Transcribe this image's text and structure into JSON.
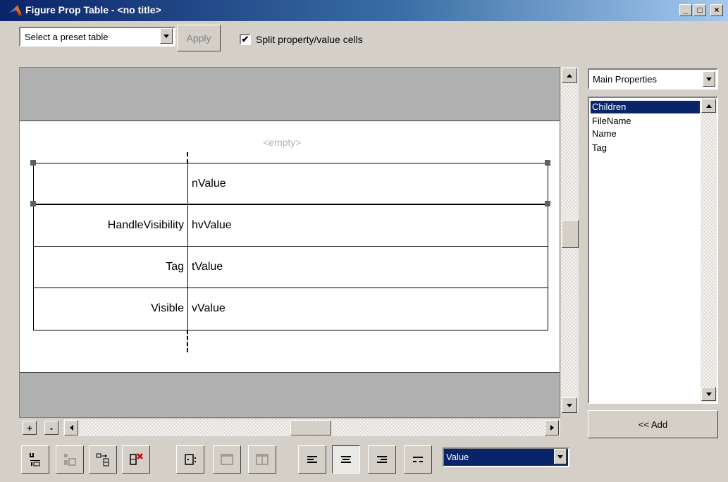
{
  "window": {
    "title": "Figure Prop Table - <no title>",
    "controls": [
      "_",
      "□",
      "×"
    ]
  },
  "toolbar": {
    "preset_placeholder": "Select a preset table",
    "apply_label": "Apply",
    "apply_enabled": false,
    "split_checked": true,
    "split_check_glyph": "✔",
    "split_label": "Split property/value cells"
  },
  "canvas": {
    "empty_placeholder": "<empty>",
    "rows": [
      {
        "property": "",
        "value": "nValue",
        "selected": true
      },
      {
        "property": "HandleVisibility",
        "value": "hvValue",
        "selected": false
      },
      {
        "property": "Tag",
        "value": "tValue",
        "selected": false
      },
      {
        "property": "Visible",
        "value": "vValue",
        "selected": false
      }
    ],
    "add_row_label": "+",
    "remove_row_label": "-"
  },
  "properties_panel": {
    "category": "Main Properties",
    "items": [
      "Children",
      "FileName",
      "Name",
      "Tag"
    ],
    "selected_index": 0,
    "add_label": "<< Add"
  },
  "bottom_toolbar": {
    "tools": [
      {
        "name": "insert-row-above-icon",
        "enabled": true
      },
      {
        "name": "insert-row-below-icon",
        "enabled": false
      },
      {
        "name": "split-cell-icon",
        "enabled": true
      },
      {
        "name": "delete-row-icon",
        "enabled": true
      },
      {
        "name": "merge-cell-icon",
        "enabled": true
      },
      {
        "name": "cell-frame-icon",
        "enabled": false
      },
      {
        "name": "cell-columns-icon",
        "enabled": false
      },
      {
        "name": "align-left-icon",
        "enabled": true
      },
      {
        "name": "align-center-icon",
        "enabled": true,
        "pressed": true
      },
      {
        "name": "align-right-icon",
        "enabled": true
      },
      {
        "name": "align-split-icon",
        "enabled": true
      }
    ],
    "cell_part_value": "Value"
  }
}
